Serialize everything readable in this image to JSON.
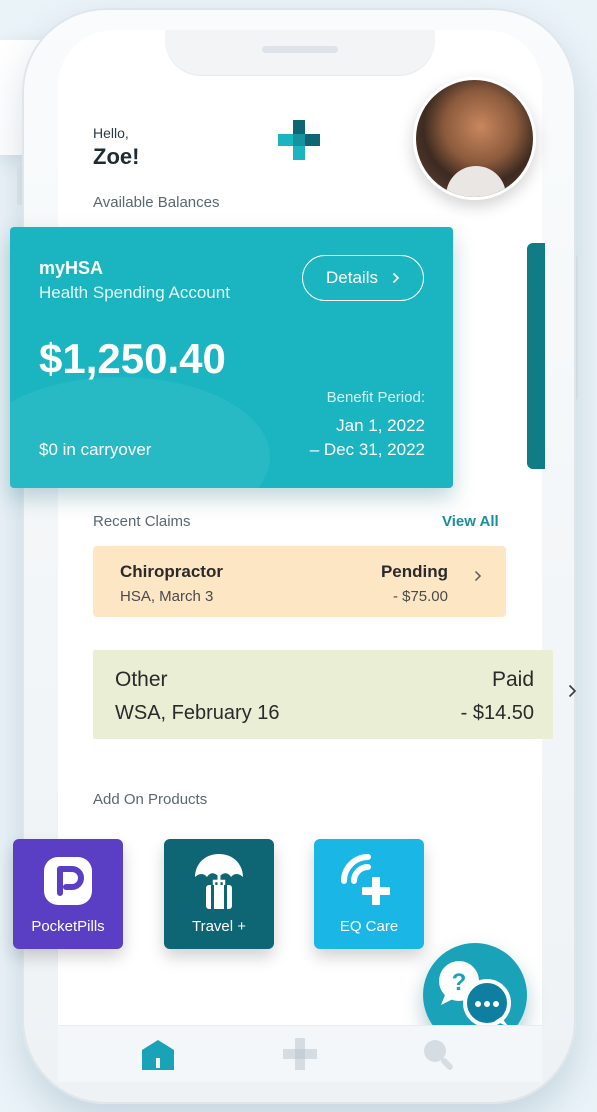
{
  "header": {
    "greeting": "Hello,",
    "user_name": "Zoe!",
    "available_balances_label": "Available Balances"
  },
  "hsa_card": {
    "title": "myHSA",
    "subtitle": "Health Spending Account",
    "details_label": "Details",
    "amount": "$1,250.40",
    "benefit_period_label": "Benefit Period:",
    "period_start": "Jan 1, 2022",
    "period_end": "– Dec 31, 2022",
    "carryover": "$0 in carryover",
    "color": "#1ab5c1"
  },
  "claims": {
    "label": "Recent Claims",
    "view_all": "View All",
    "items": [
      {
        "title": "Chiropractor",
        "sub": "HSA, March 3",
        "status": "Pending",
        "amount": "- $75.00",
        "color": "#fde6c4"
      },
      {
        "title": "Other",
        "sub": "WSA, February 16",
        "status": "Paid",
        "amount": "- $14.50",
        "color": "#e9eed5"
      }
    ]
  },
  "addons": {
    "label": "Add On Products",
    "items": [
      {
        "label": "PocketPills",
        "icon": "pocketpills-icon",
        "color": "#5a3fc4"
      },
      {
        "label": "Travel +",
        "icon": "umbrella-luggage-icon",
        "color": "#0e6573"
      },
      {
        "label": "EQ Care",
        "icon": "signal-plus-icon",
        "color": "#1ab6e6"
      }
    ]
  },
  "chat": {
    "icon": "chat-help-icon",
    "question_mark": "?",
    "color": "#1aa3b8"
  },
  "nav": {
    "items": [
      "home-icon",
      "cross-icon",
      "search-icon"
    ]
  },
  "colors": {
    "accent": "#1ab5c1",
    "dark_teal": "#0e6573",
    "link": "#1a8f9c"
  }
}
